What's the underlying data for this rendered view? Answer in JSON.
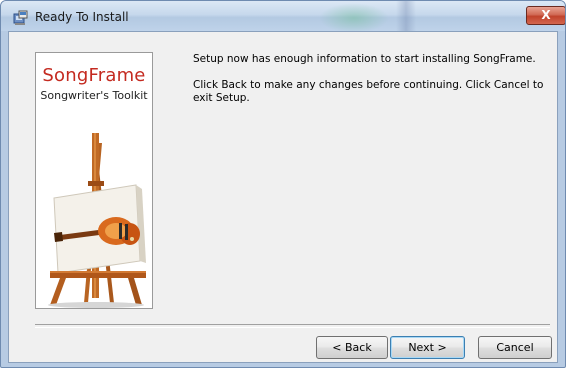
{
  "window": {
    "title": "Ready To Install",
    "close_symbol": "X",
    "icon": "installer-icon"
  },
  "branding": {
    "product_name": "SongFrame",
    "tagline": "Songwriter's Toolkit",
    "accent_color": "#c42a20"
  },
  "content": {
    "message_ready": "Setup now has enough information to start installing SongFrame.",
    "message_instructions": "Click Back to make any changes before continuing. Click Cancel to exit Setup."
  },
  "buttons": {
    "back_label": "< Back",
    "next_label": "Next >",
    "cancel_label": "Cancel"
  }
}
